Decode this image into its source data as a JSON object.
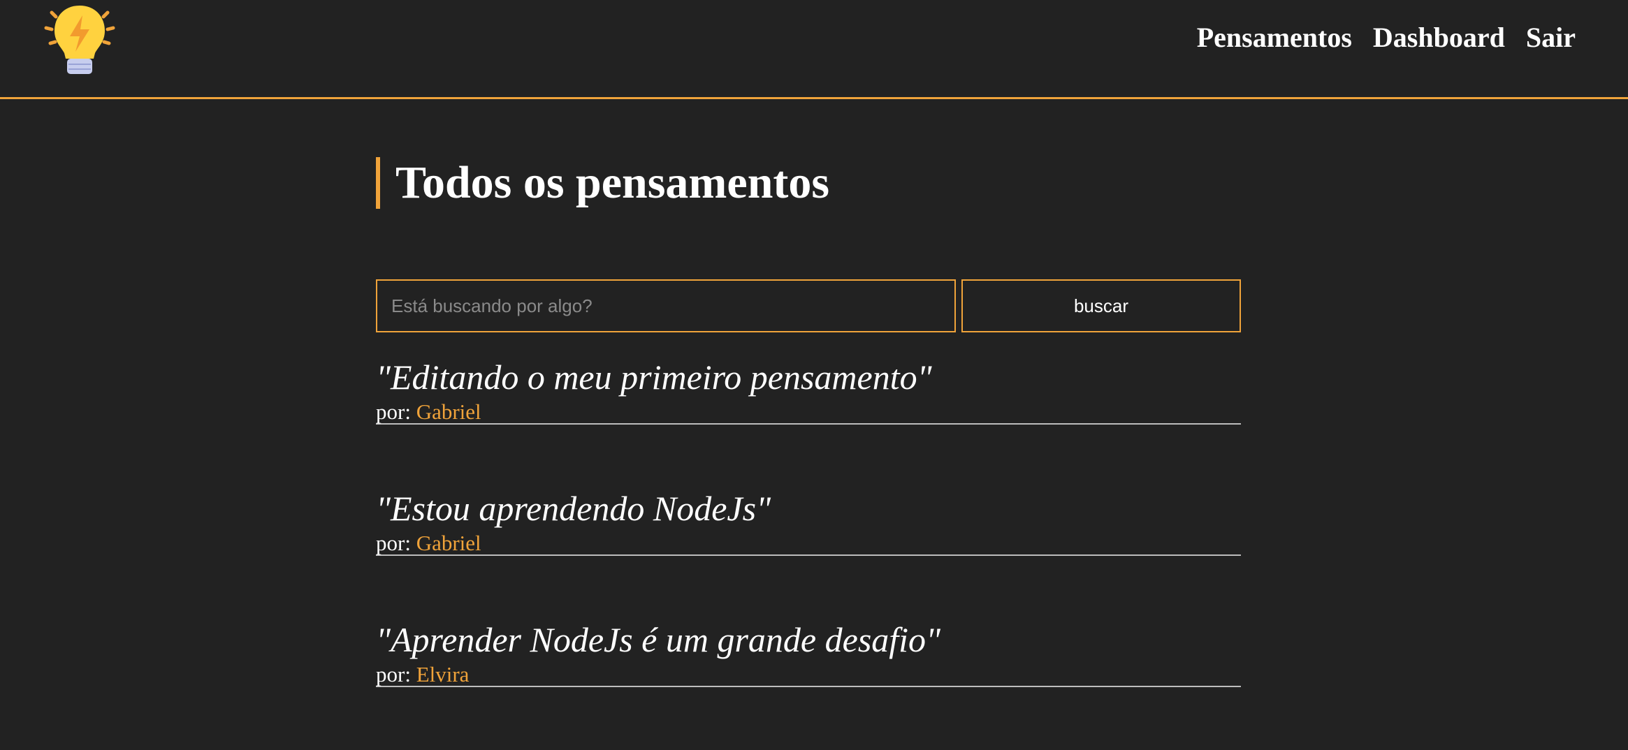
{
  "nav": {
    "links": [
      "Pensamentos",
      "Dashboard",
      "Sair"
    ]
  },
  "main": {
    "title": "Todos os pensamentos",
    "search": {
      "placeholder": "Está buscando por algo?",
      "value": "",
      "button_label": "buscar"
    },
    "thoughts": [
      {
        "text": "\"Editando o meu primeiro pensamento\"",
        "author_prefix": "por:",
        "author": "Gabriel"
      },
      {
        "text": "\"Estou aprendendo NodeJs\"",
        "author_prefix": "por:",
        "author": "Gabriel"
      },
      {
        "text": "\"Aprender NodeJs é um grande desafio\"",
        "author_prefix": "por:",
        "author": "Elvira"
      }
    ]
  },
  "colors": {
    "background": "#222222",
    "accent": "#f0a33a",
    "text": "#ffffff",
    "divider": "#bdbdbd"
  },
  "icons": {
    "logo": "lightbulb-bolt-icon"
  }
}
